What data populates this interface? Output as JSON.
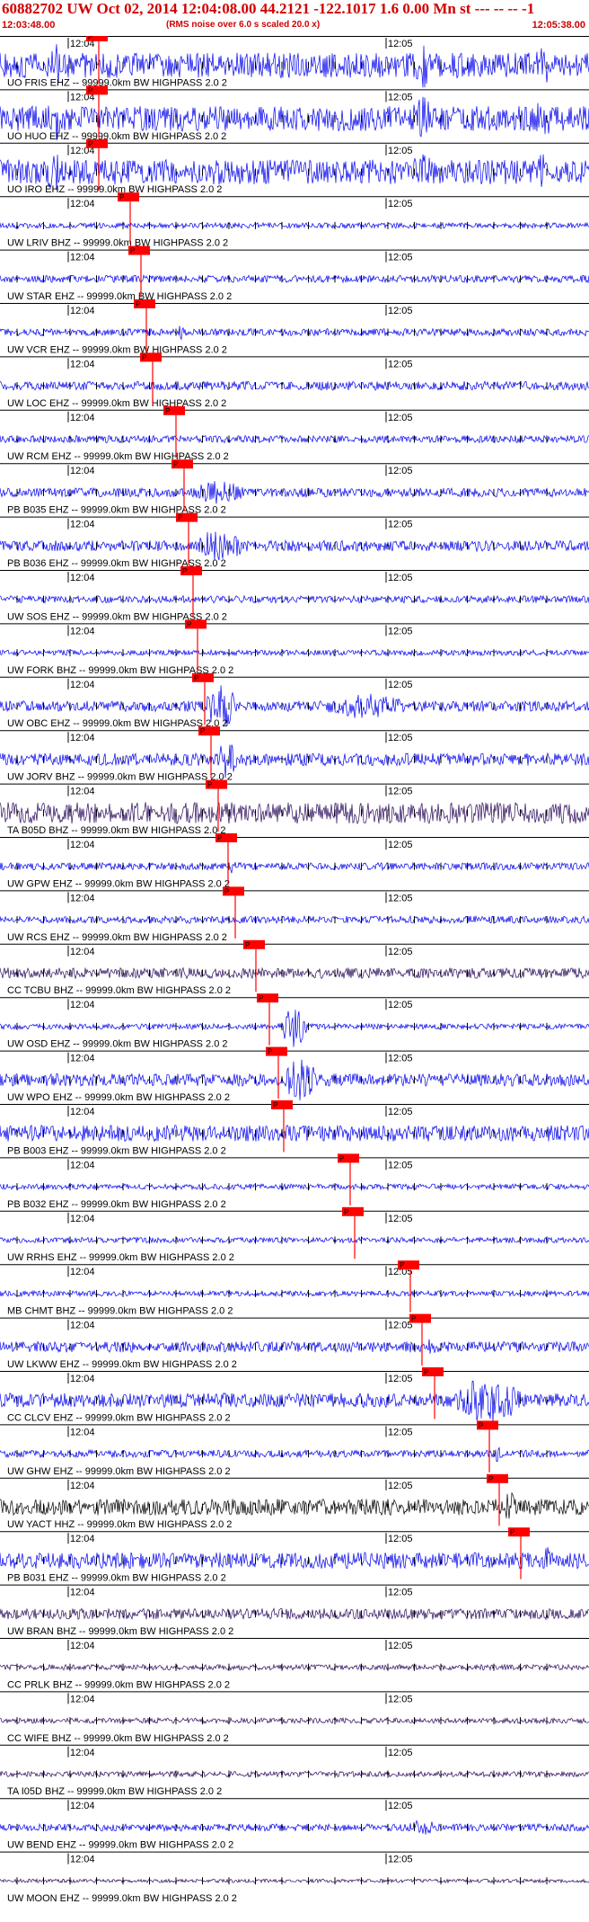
{
  "header": {
    "title": "60882702 UW Oct 02, 2014 12:04:08.00   44.2121 -122.1017  1.6 0.00 Mn st --- -- --   -1",
    "start_time": "12:03:48.00",
    "scaling_note": "(RMS noise over 6.0 s scaled 20.0 x)",
    "end_time": "12:05:38.00"
  },
  "colors": {
    "header_red": "#d00000",
    "pick_red": "#ff0000",
    "trace_blue": "#0000ee",
    "trace_dark": "#2a0a5a",
    "trace_black": "#000000"
  },
  "chart_data": {
    "type": "seismogram",
    "time_range": [
      "12:03:48.00",
      "12:05:38.00"
    ],
    "time_marks": [
      "12:04",
      "12:05"
    ],
    "traces": [
      {
        "label": "UO FRIS EHZ -- 99999.0km BW  HIGHPASS  2.0  2",
        "pick": "P"
      },
      {
        "label": "UO HUO EHZ -- 99999.0km BW  HIGHPASS  2.0  2",
        "pick": "P"
      },
      {
        "label": "UO IRO EHZ -- 99999.0km BW  HIGHPASS  2.0  2",
        "pick": "P"
      },
      {
        "label": "UW LRIV BHZ -- 99999.0km BW  HIGHPASS  2.0  2",
        "pick": "P"
      },
      {
        "label": "UW STAR EHZ -- 99999.0km BW  HIGHPASS  2.0  2",
        "pick": "P"
      },
      {
        "label": "UW VCR EHZ -- 99999.0km BW  HIGHPASS  2.0  2",
        "pick": "P"
      },
      {
        "label": "UW LOC EHZ -- 99999.0km BW  HIGHPASS  2.0  2",
        "pick": "P"
      },
      {
        "label": "UW RCM EHZ -- 99999.0km BW  HIGHPASS  2.0  2",
        "pick": "P"
      },
      {
        "label": "PB B035 EHZ -- 99999.0km BW  HIGHPASS  2.0  2",
        "pick": "P"
      },
      {
        "label": "PB B036 EHZ -- 99999.0km BW  HIGHPASS  2.0  2",
        "pick": "P"
      },
      {
        "label": "UW SOS EHZ -- 99999.0km BW  HIGHPASS  2.0  2",
        "pick": "P"
      },
      {
        "label": "UW FORK BHZ -- 99999.0km BW  HIGHPASS  2.0  2",
        "pick": "P"
      },
      {
        "label": "UW OBC EHZ -- 99999.0km BW  HIGHPASS  2.0  2",
        "pick": "P"
      },
      {
        "label": "UW JORV BHZ -- 99999.0km BW  HIGHPASS  2.0  2",
        "pick": "P"
      },
      {
        "label": "TA B05D BHZ -- 99999.0km BW  HIGHPASS  2.0  2",
        "pick": "P"
      },
      {
        "label": "UW GPW EHZ -- 99999.0km BW  HIGHPASS  2.0  2",
        "pick": "P"
      },
      {
        "label": "UW RCS EHZ -- 99999.0km BW  HIGHPASS  2.0  2",
        "pick": "P"
      },
      {
        "label": "CC TCBU BHZ -- 99999.0km BW  HIGHPASS  2.0  2",
        "pick": "P"
      },
      {
        "label": "UW OSD EHZ -- 99999.0km BW  HIGHPASS  2.0  2",
        "pick": "P"
      },
      {
        "label": "UW WPO EHZ -- 99999.0km BW  HIGHPASS  2.0  2",
        "pick": "P"
      },
      {
        "label": "PB B003 EHZ -- 99999.0km BW  HIGHPASS  2.0  2",
        "pick": "P"
      },
      {
        "label": "PB B032 EHZ -- 99999.0km BW  HIGHPASS  2.0  2",
        "pick": "P"
      },
      {
        "label": "UW RRHS EHZ -- 99999.0km BW  HIGHPASS  2.0  2",
        "pick": "P"
      },
      {
        "label": "MB CHMT BHZ -- 99999.0km BW  HIGHPASS  2.0  2",
        "pick": "P"
      },
      {
        "label": "UW LKWW EHZ -- 99999.0km BW  HIGHPASS  2.0  2",
        "pick": "P"
      },
      {
        "label": "CC CLCV EHZ -- 99999.0km BW  HIGHPASS  2.0  2",
        "pick": "P"
      },
      {
        "label": "UW GHW EHZ -- 99999.0km BW  HIGHPASS  2.0  2",
        "pick": "P"
      },
      {
        "label": "UW YACT HHZ -- 99999.0km BW  HIGHPASS  2.0  2",
        "pick": "P"
      },
      {
        "label": "PB B031 EHZ -- 99999.0km BW  HIGHPASS  2.0  2",
        "pick": "P"
      },
      {
        "label": "UW BRAN BHZ -- 99999.0km BW  HIGHPASS  2.0  2",
        "pick": ""
      },
      {
        "label": "CC PRLK BHZ -- 99999.0km BW  HIGHPASS  2.0  2",
        "pick": ""
      },
      {
        "label": "CC WIFE BHZ -- 99999.0km BW  HIGHPASS  2.0  2",
        "pick": ""
      },
      {
        "label": "TA I05D BHZ -- 99999.0km BW  HIGHPASS  2.0  2",
        "pick": ""
      },
      {
        "label": "UW BEND EHZ -- 99999.0km BW  HIGHPASS  2.0  2",
        "pick": ""
      },
      {
        "label": "UW MOON EHZ -- 99999.0km BW  HIGHPASS  2.0  2",
        "pick": ""
      }
    ]
  }
}
